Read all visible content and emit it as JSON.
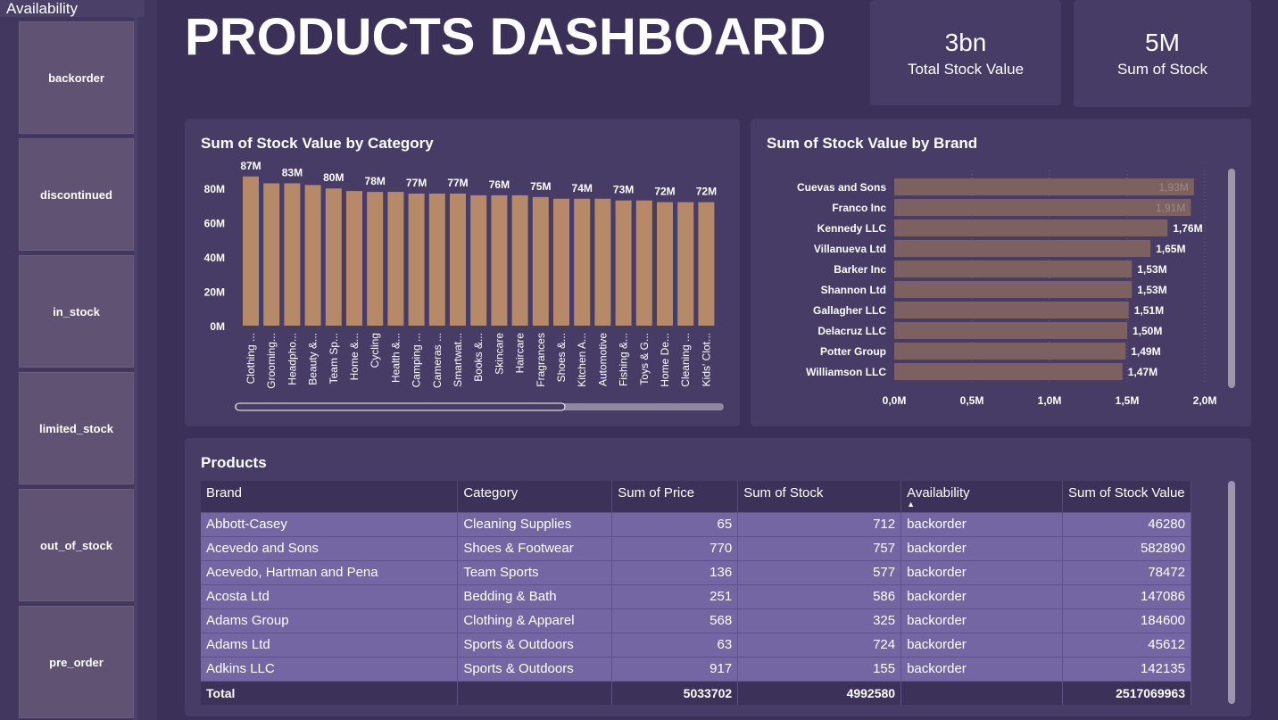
{
  "slicer": {
    "title": "Availability",
    "items": [
      "backorder",
      "discontinued",
      "in_stock",
      "limited_stock",
      "out_of_stock",
      "pre_order"
    ]
  },
  "header": {
    "title": "PRODUCTS DASHBOARD"
  },
  "cards": [
    {
      "value": "3bn",
      "label": "Total Stock Value"
    },
    {
      "value": "5M",
      "label": "Sum of Stock"
    }
  ],
  "colors": {
    "bar_category": "#b68a69",
    "bar_brand": "#7c6160",
    "background": "#3b3158",
    "panel": "#463c66",
    "row": "#7466a3"
  },
  "chart_data": [
    {
      "type": "bar",
      "title": "Sum of Stock Value by Category",
      "categories": [
        "Clothing ...",
        "Grooming...",
        "Headpho...",
        "Beauty &...",
        "Team Sp...",
        "Home &...",
        "Cycling",
        "Health &...",
        "Camping ...",
        "Cameras ...",
        "Smartwat...",
        "Books &...",
        "Skincare",
        "Haircare",
        "Fragrances",
        "Shoes &...",
        "Kitchen A...",
        "Automotive",
        "Fishing &...",
        "Toys & G...",
        "Home De...",
        "Cleaning ...",
        "Kids' Clot..."
      ],
      "values": [
        87,
        83,
        83,
        82,
        80,
        78.5,
        78,
        78,
        77,
        77,
        77,
        76,
        76,
        76,
        75,
        74,
        74,
        74,
        73,
        73,
        72,
        72,
        72
      ],
      "data_labels": [
        "87M",
        "",
        "83M",
        "",
        "80M",
        "",
        "78M",
        "",
        "77M",
        "",
        "77M",
        "",
        "76M",
        "",
        "75M",
        "",
        "74M",
        "",
        "73M",
        "",
        "72M",
        "",
        "72M"
      ],
      "y_ticks": [
        "0M",
        "20M",
        "40M",
        "60M",
        "80M"
      ],
      "ylim": [
        0,
        90
      ],
      "grid": false,
      "xlabel": "",
      "ylabel": ""
    },
    {
      "type": "bar",
      "orientation": "horizontal",
      "title": "Sum of Stock Value by Brand",
      "categories": [
        "Cuevas and Sons",
        "Franco Inc",
        "Kennedy LLC",
        "Villanueva Ltd",
        "Barker Inc",
        "Shannon Ltd",
        "Gallagher LLC",
        "Delacruz LLC",
        "Potter Group",
        "Williamson LLC"
      ],
      "values": [
        1.93,
        1.91,
        1.76,
        1.65,
        1.53,
        1.53,
        1.51,
        1.5,
        1.49,
        1.47
      ],
      "data_labels": [
        "1,93M",
        "1,91M",
        "1,76M",
        "1,65M",
        "1,53M",
        "1,53M",
        "1,51M",
        "1,50M",
        "1,49M",
        "1,47M"
      ],
      "x_ticks": [
        "0,0M",
        "0,5M",
        "1,0M",
        "1,5M",
        "2,0M"
      ],
      "xlim": [
        0,
        2.0
      ],
      "grid": true,
      "xlabel": "",
      "ylabel": ""
    }
  ],
  "table": {
    "title": "Products",
    "columns": [
      "Brand",
      "Category",
      "Sum of Price",
      "Sum of Stock",
      "Availability",
      "Sum of Stock Value"
    ],
    "sort_indicator": "▲",
    "rows": [
      [
        "Abbott-Casey",
        "Cleaning Supplies",
        "65",
        "712",
        "backorder",
        "46280"
      ],
      [
        "Acevedo and Sons",
        "Shoes & Footwear",
        "770",
        "757",
        "backorder",
        "582890"
      ],
      [
        "Acevedo, Hartman and Pena",
        "Team Sports",
        "136",
        "577",
        "backorder",
        "78472"
      ],
      [
        "Acosta Ltd",
        "Bedding & Bath",
        "251",
        "586",
        "backorder",
        "147086"
      ],
      [
        "Adams Group",
        "Clothing & Apparel",
        "568",
        "325",
        "backorder",
        "184600"
      ],
      [
        "Adams Ltd",
        "Sports & Outdoors",
        "63",
        "724",
        "backorder",
        "45612"
      ],
      [
        "Adkins LLC",
        "Sports & Outdoors",
        "917",
        "155",
        "backorder",
        "142135"
      ]
    ],
    "total": [
      "Total",
      "",
      "5033702",
      "4992580",
      "",
      "2517069963"
    ]
  }
}
